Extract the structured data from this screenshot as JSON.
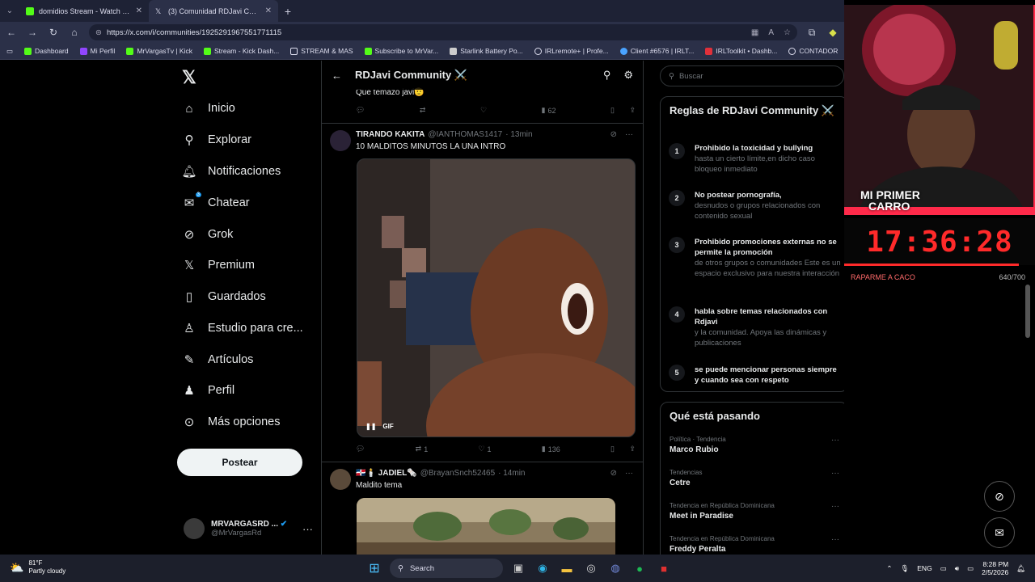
{
  "tabs": [
    {
      "label": "domidios Stream - Watch Live on",
      "color": "#53fc18"
    },
    {
      "label": "(3) Comunidad RDJavi Community",
      "color": "#ffffff"
    }
  ],
  "url": "https://x.com/i/communities/1925291967551771115",
  "bookmarks": [
    "Dashboard",
    "Mi Perfil",
    "MrVargasTv | Kick",
    "Stream - Kick Dash...",
    "STREAM & MAS",
    "Subscribe to MrVar...",
    "Starlink Battery Po...",
    "IRLremote+ | Profe...",
    "Client #6576 | IRLT...",
    "IRLToolkit • Dashb...",
    "CONTADOR"
  ],
  "nav": {
    "items": [
      "Inicio",
      "Explorar",
      "Notificaciones",
      "Chatear",
      "Grok",
      "Premium",
      "Guardados",
      "Estudio para cre...",
      "Artículos",
      "Perfil",
      "Más opciones"
    ],
    "chat_badge": "3",
    "post_button": "Postear",
    "profile_name": "MRVARGASRD ...",
    "profile_handle": "@MrVargasRd"
  },
  "feed": {
    "title": "RDJavi Community ⚔️",
    "prev_text": "Que temazo javi🫡",
    "prev_views": "62",
    "post1": {
      "name": "TIRANDO KAKITA",
      "handle": "@IANTHOMAS1417",
      "time": "· 13min",
      "text": "10 MALDITOS MINUTOS LA UNA INTRO",
      "gif_label": "GIF",
      "retweets": "1",
      "likes": "1",
      "views": "136"
    },
    "post2": {
      "name": "🇩🇴🕯️ JADIEL🗞️",
      "handle": "@BrayanSnch52465",
      "time": "· 14min",
      "text": "Maldito tema"
    }
  },
  "right": {
    "search_placeholder": "Buscar",
    "rules_title": "Reglas de RDJavi Community ⚔️",
    "rules": [
      {
        "n": "1",
        "t": "Prohibido la toxicidad y bullying",
        "d": "hasta un cierto límite,en dicho caso bloqueo inmediato"
      },
      {
        "n": "2",
        "t": "No postear pornografía,",
        "d": "desnudos o grupos relacionados con contenido sexual"
      },
      {
        "n": "3",
        "t": "Prohibido promociones externas no se permite la promoción",
        "d": "de otros grupos o comunidades Este es un espacio exclusivo para nuestra interacción"
      },
      {
        "n": "4",
        "t": "habla sobre temas relacionados con Rdjavi",
        "d": "y la comunidad. Apoya las dinámicas y publicaciones"
      },
      {
        "n": "5",
        "t": "se puede mencionar personas siempre y cuando sea con respeto",
        "d": ""
      }
    ],
    "trends_title": "Qué está pasando",
    "trends": [
      {
        "c": "Política · Tendencia",
        "n": "Marco Rubio"
      },
      {
        "c": "Tendencias",
        "n": "Cetre"
      },
      {
        "c": "Tendencia en República Dominicana",
        "n": "Meet in Paradise"
      },
      {
        "c": "Tendencia en República Dominicana",
        "n": "Freddy Peralta"
      }
    ]
  },
  "overlay": {
    "cam_text_1": "MI PRIMER",
    "cam_text_2": "CARRO",
    "clock": "17:36:28",
    "goal_label": "RAPARME A CACO",
    "goal_value": "640/700",
    "goal_fraction": 0.914
  },
  "taskbar": {
    "temp": "81°F",
    "weather": "Partly cloudy",
    "search": "Search",
    "lang": "ENG",
    "time": "8:28 PM",
    "date": "2/5/2026"
  }
}
